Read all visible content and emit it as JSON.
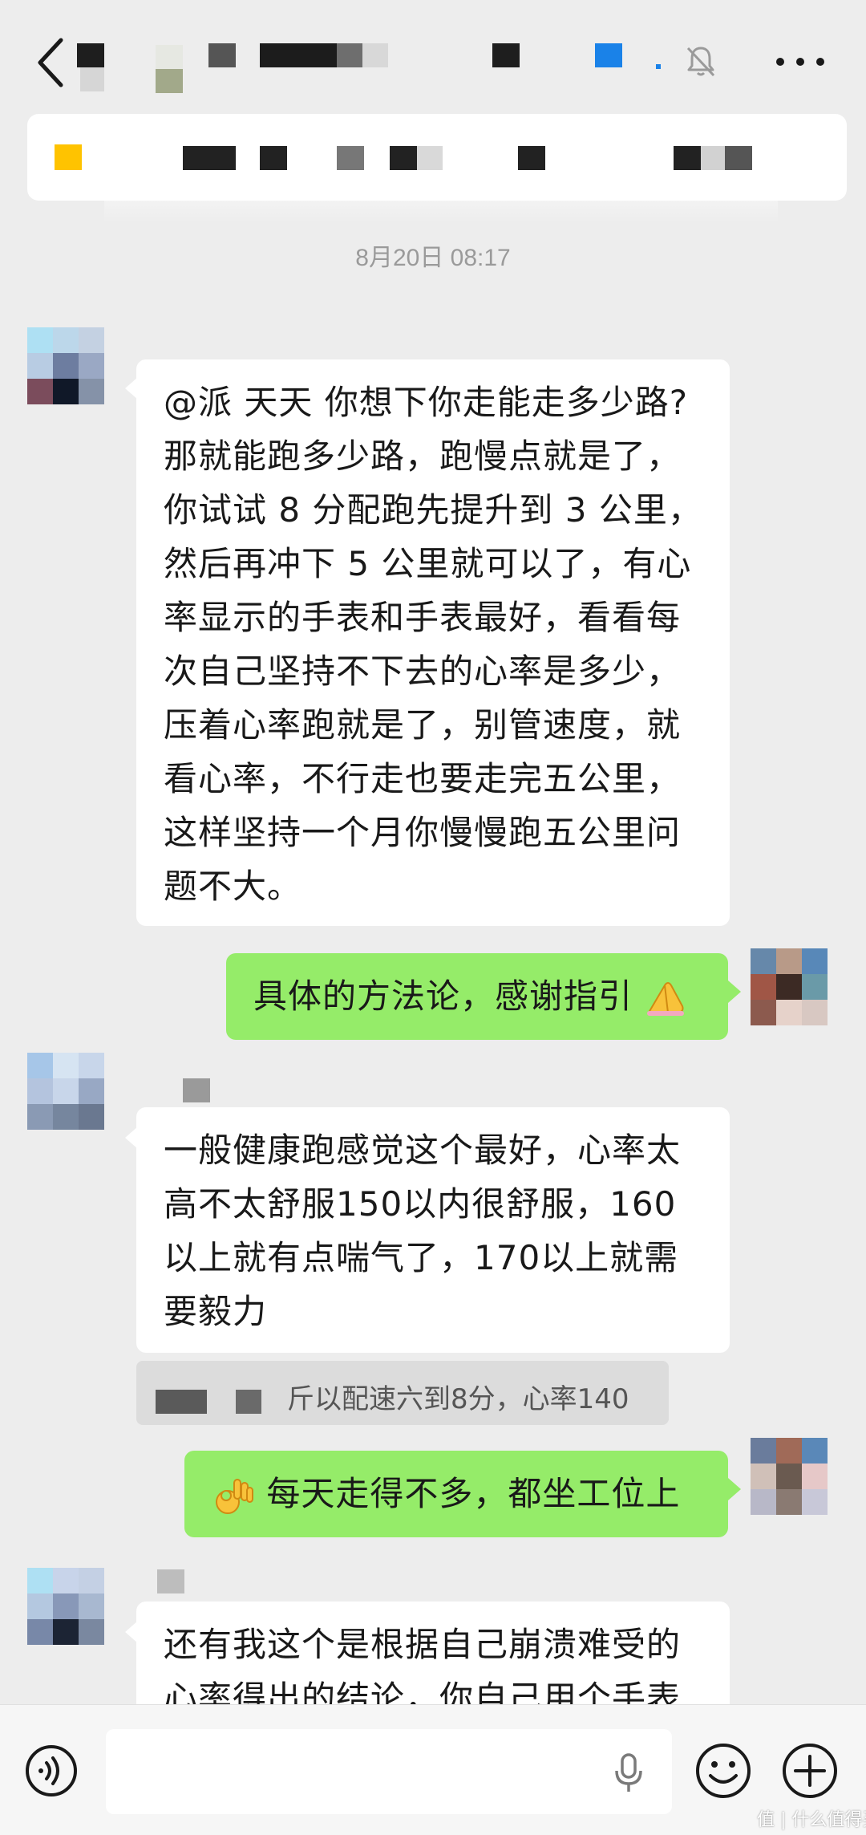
{
  "header": {
    "back_icon": "chevron-left-icon",
    "mute_icon": "bell-muted-icon",
    "more_icon": "more-dots-icon"
  },
  "timestamp": "8月20日 08:17",
  "messages": [
    {
      "id": "m1",
      "direction": "incoming",
      "lines": [
        "@派 天天  你想下你走能走多少路?",
        "那就能跑多少路，跑慢点就是了，",
        "你试试 8 分配跑先提升到 3 公里，",
        "然后再冲下 5 公里就可以了，有心",
        "率显示的手表和手表最好，看看每",
        "次自己坚持不下去的心率是多少，",
        "压着心率跑就是了，别管速度，就",
        "看心率，不行走也要走完五公里，",
        "这样坚持一个月你慢慢跑五公里问",
        "题不大。"
      ]
    },
    {
      "id": "m2",
      "direction": "outgoing",
      "text": "具体的方法论，感谢指引",
      "trailing_emoji": "pray-hands-emoji"
    },
    {
      "id": "m3",
      "direction": "incoming",
      "lines": [
        "一般健康跑感觉这个最好，心率太",
        "高不太舒服150以内很舒服，160",
        "以上就有点喘气了，170以上就需",
        "要毅力"
      ]
    },
    {
      "id": "m3-quote",
      "direction": "quote",
      "text": "斤以配速六到8分，心率140"
    },
    {
      "id": "m4",
      "direction": "outgoing",
      "leading_emoji": "ok-hand-emoji",
      "text": "每天走得不多，都坐工位上"
    },
    {
      "id": "m5",
      "direction": "incoming",
      "lines": [
        "还有我这个是根据自己崩溃难受的",
        "心率得出的结论，你自己用个手表"
      ]
    }
  ],
  "input_bar": {
    "voice_icon": "voice-toggle-icon",
    "mic_icon": "microphone-icon",
    "emoji_icon": "smiley-icon",
    "plus_icon": "plus-icon"
  },
  "watermark": "值 | 什么值得买",
  "colors": {
    "background": "#ededed",
    "incoming_bubble": "#ffffff",
    "outgoing_bubble": "#95ec69",
    "notice_accent": "#ffc300",
    "header_accent": "#1a82e8"
  }
}
